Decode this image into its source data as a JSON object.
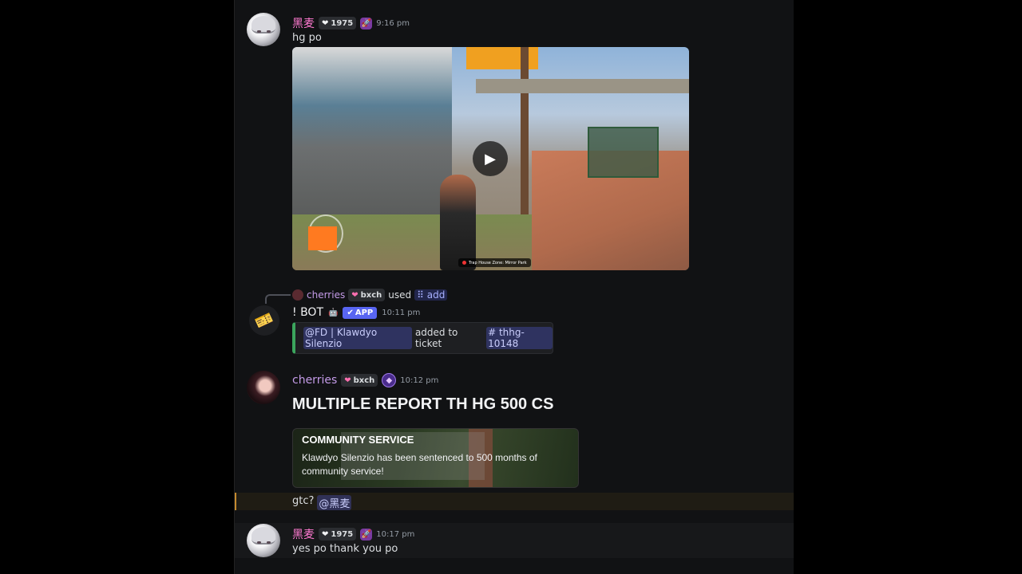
{
  "messages": [
    {
      "username": "黑麦",
      "badge": "1975",
      "time": "9:16 pm",
      "text": "hg po"
    },
    {
      "reply_user": "cherries",
      "reply_badge": "bxch",
      "reply_used": "used",
      "reply_command": "add",
      "username": "! BOT",
      "app_badge": "APP",
      "time": "10:11 pm",
      "embed_mention": "@FD | Klawdyo Silenzio",
      "embed_text": "added to ticket",
      "embed_channel": "thhg-10148"
    },
    {
      "username": "cherries",
      "badge": "bxch",
      "time": "10:12 pm",
      "heading": "MULTIPLE REPORT TH HG 500 CS",
      "card_title": "COMMUNITY SERVICE",
      "card_body": "Klawdyo Silenzio has been sentenced to 500 months of community service!",
      "followup_text": "gtc?",
      "followup_mention": "@黑麦"
    },
    {
      "username": "黑麦",
      "badge": "1975",
      "time": "10:17 pm",
      "text": "yes po thank you po"
    }
  ],
  "video": {
    "hud_location": "Trap House Zone: Mirror Park"
  }
}
